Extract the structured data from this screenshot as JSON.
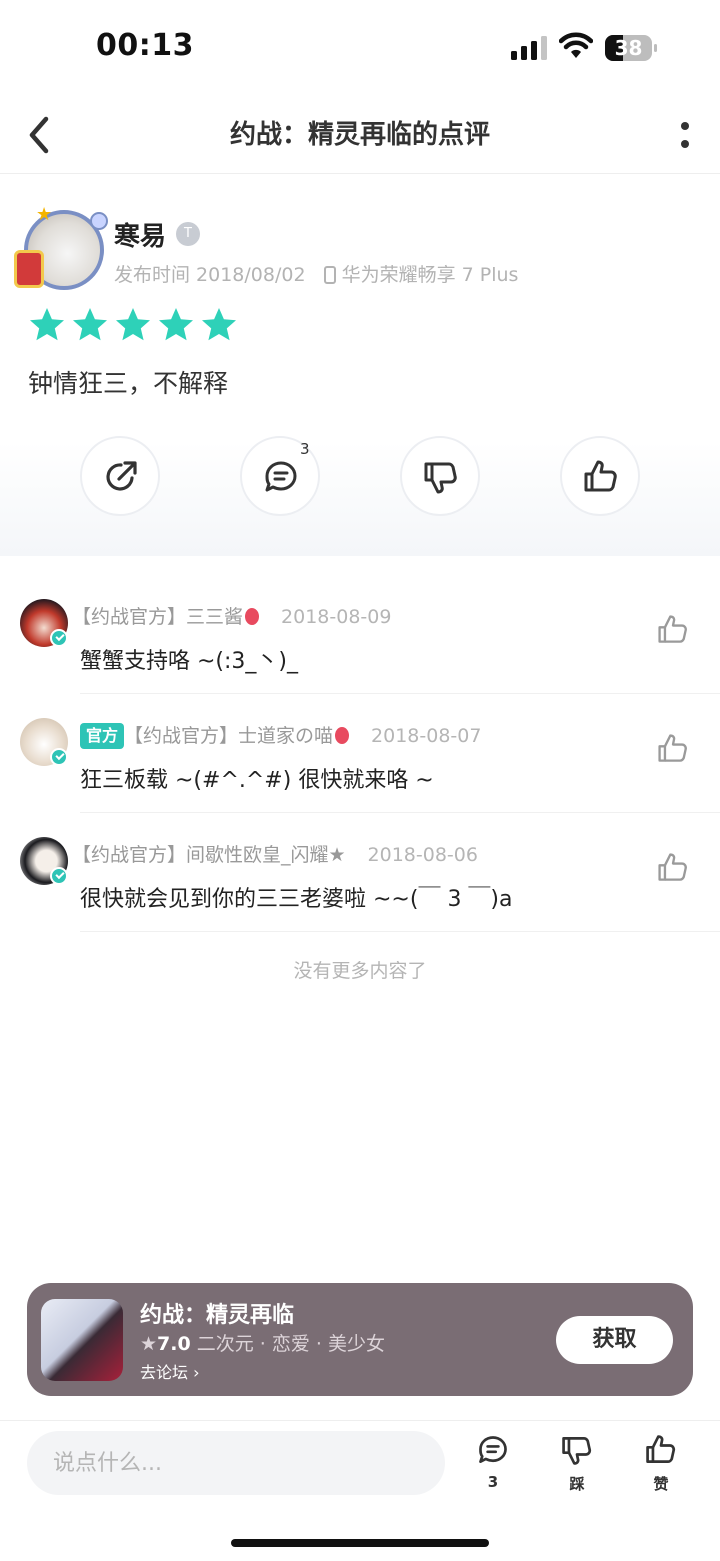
{
  "status_bar": {
    "time": "00:13",
    "battery": "38",
    "battery_level_percent": 38
  },
  "nav": {
    "title": "约战：精灵再临的点评",
    "back_icon": "chevron-left-icon",
    "more_icon": "more-vertical-icon"
  },
  "review": {
    "user_name": "寒易",
    "level_badge": "T",
    "publish_label": "发布时间 2018/08/02",
    "device": "华为荣耀畅享 7 Plus",
    "rating_stars": 5,
    "star_color": "#2ed1b8",
    "text": "钟情狂三，不解释",
    "actions": [
      {
        "name": "share",
        "icon": "share-icon",
        "count": ""
      },
      {
        "name": "comment",
        "icon": "comment-icon",
        "count": "3"
      },
      {
        "name": "dislike",
        "icon": "thumbs-down-icon",
        "count": ""
      },
      {
        "name": "like",
        "icon": "thumbs-up-icon",
        "count": ""
      }
    ]
  },
  "comments": [
    {
      "badge": "",
      "author": "【约战官方】三三酱",
      "date": "2018-08-09",
      "text": "蟹蟹支持咯 ~(:3_丶)_"
    },
    {
      "badge": "官方",
      "author": "【约战官方】士道家の喵",
      "date": "2018-08-07",
      "text": "狂三板载 ~(#^.^#) 很快就来咯 ~"
    },
    {
      "badge": "",
      "author": "【约战官方】间歇性欧皇_闪耀★",
      "date": "2018-08-06",
      "text": "很快就会见到你的三三老婆啦 ~~(￣ 3 ￣)a"
    }
  ],
  "no_more": "没有更多内容了",
  "game_card": {
    "title": "约战：精灵再临",
    "rating": "7.0",
    "tags": "二次元 · 恋爱 · 美少女",
    "forum_link": "去论坛",
    "get_button": "获取",
    "background": "#7a6d74"
  },
  "bottom_bar": {
    "input_placeholder": "说点什么...",
    "comment_count": "3",
    "dislike_label": "踩",
    "like_label": "赞"
  },
  "colors": {
    "accent": "#2ec4b6",
    "text_primary": "#222222",
    "text_secondary": "#b3b3b3"
  }
}
